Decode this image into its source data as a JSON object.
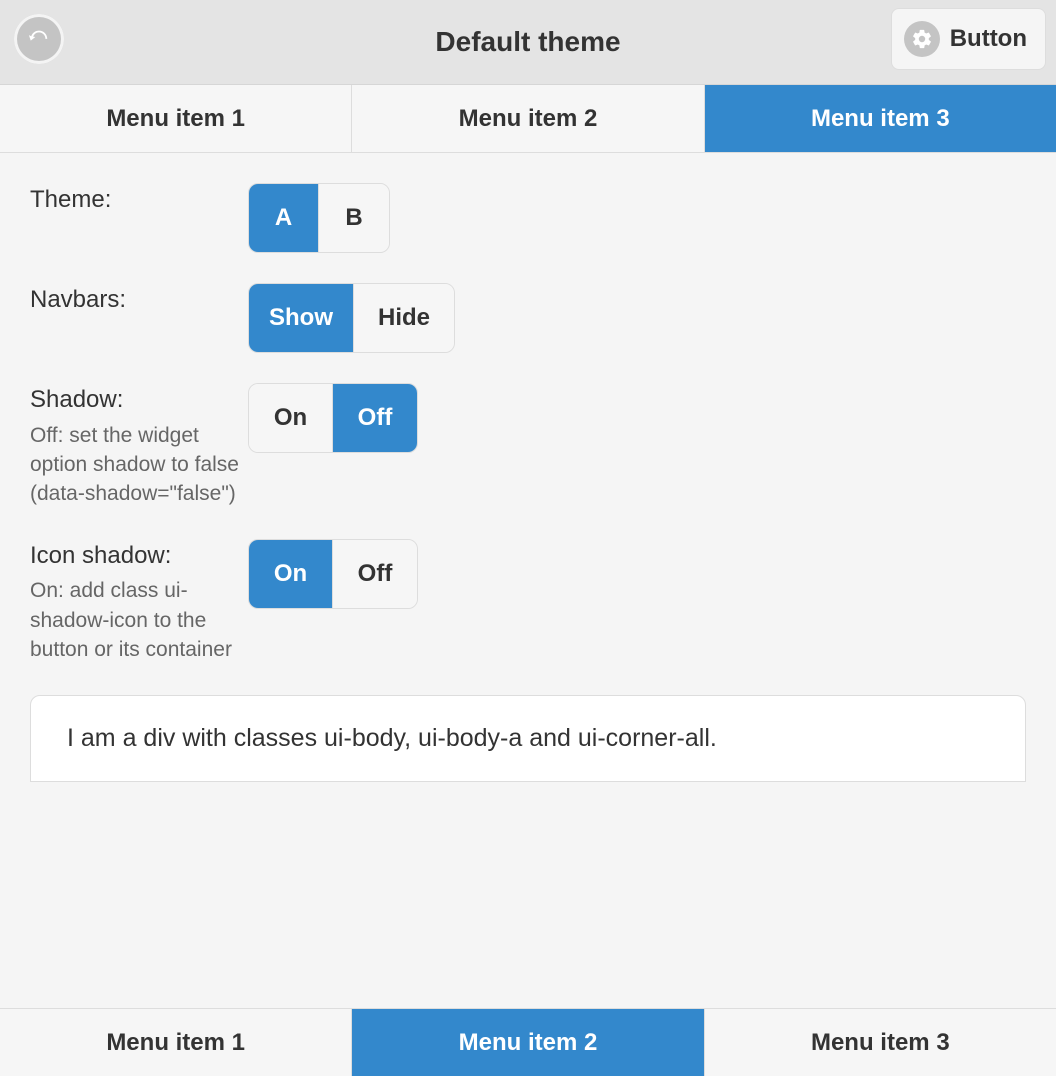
{
  "colors": {
    "accent": "#3388cc"
  },
  "header": {
    "title": "Default theme",
    "button_label": "Button"
  },
  "top_nav": {
    "items": [
      {
        "label": "Menu item 1",
        "active": false
      },
      {
        "label": "Menu item 2",
        "active": false
      },
      {
        "label": "Menu item 3",
        "active": true
      }
    ]
  },
  "settings": {
    "theme": {
      "label": "Theme:",
      "options": [
        {
          "label": "A",
          "active": true
        },
        {
          "label": "B",
          "active": false
        }
      ]
    },
    "navbars": {
      "label": "Navbars:",
      "options": [
        {
          "label": "Show",
          "active": true
        },
        {
          "label": "Hide",
          "active": false
        }
      ]
    },
    "shadow": {
      "label": "Shadow:",
      "desc": "Off: set the widget option shadow to false (data-shadow=\"false\")",
      "options": [
        {
          "label": "On",
          "active": false
        },
        {
          "label": "Off",
          "active": true
        }
      ]
    },
    "icon_shadow": {
      "label": "Icon shadow:",
      "desc": "On: add class ui-shadow-icon to the button or its container",
      "options": [
        {
          "label": "On",
          "active": true
        },
        {
          "label": "Off",
          "active": false
        }
      ]
    }
  },
  "body_demo": {
    "text": "I am a div with classes ui-body, ui-body-a and ui-corner-all."
  },
  "footer_nav": {
    "items": [
      {
        "label": "Menu item 1",
        "active": false
      },
      {
        "label": "Menu item 2",
        "active": true
      },
      {
        "label": "Menu item 3",
        "active": false
      }
    ]
  }
}
